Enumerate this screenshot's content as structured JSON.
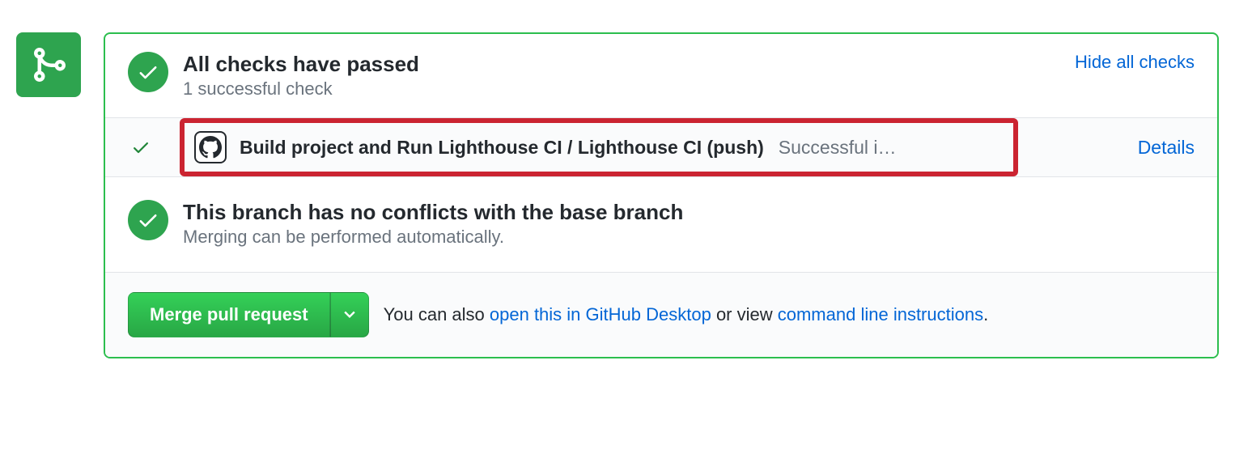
{
  "checks_summary": {
    "title": "All checks have passed",
    "subtitle": "1 successful check",
    "hide_link": "Hide all checks"
  },
  "check_item": {
    "name": "Build project and Run Lighthouse CI / Lighthouse CI (push)",
    "status": "Successful i…",
    "details_link": "Details"
  },
  "conflicts": {
    "title": "This branch has no conflicts with the base branch",
    "subtitle": "Merging can be performed automatically."
  },
  "footer": {
    "merge_button": "Merge pull request",
    "text_prefix": "You can also ",
    "link_desktop": "open this in GitHub Desktop",
    "text_middle": " or view ",
    "link_cli": "command line instructions",
    "text_suffix": "."
  }
}
